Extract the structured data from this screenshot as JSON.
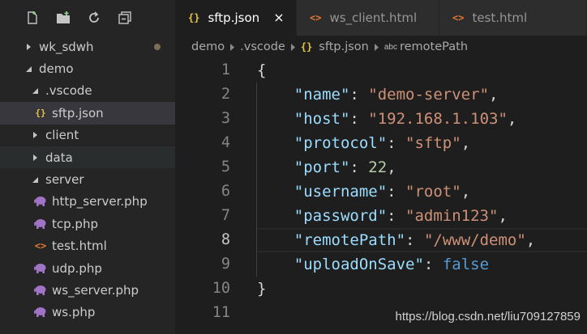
{
  "sidebar": {
    "toolbar": [
      {
        "name": "new-file-icon"
      },
      {
        "name": "new-folder-icon"
      },
      {
        "name": "refresh-icon"
      },
      {
        "name": "collapse-all-icon"
      }
    ],
    "tree": [
      {
        "label": "wk_sdwh",
        "indent": 0,
        "chevron": "right",
        "icon": null,
        "dot": true
      },
      {
        "label": "demo",
        "indent": 0,
        "chevron": "down",
        "icon": null
      },
      {
        "label": ".vscode",
        "indent": 1,
        "chevron": "down",
        "icon": null
      },
      {
        "label": "sftp.json",
        "indent": 2,
        "chevron": null,
        "icon": "json",
        "selected": true
      },
      {
        "label": "client",
        "indent": 1,
        "chevron": "right",
        "icon": null
      },
      {
        "label": "data",
        "indent": 1,
        "chevron": "right",
        "icon": null,
        "dim": true
      },
      {
        "label": "server",
        "indent": 1,
        "chevron": "down",
        "icon": null
      },
      {
        "label": "http_server.php",
        "indent": 2,
        "chevron": null,
        "icon": "php"
      },
      {
        "label": "tcp.php",
        "indent": 2,
        "chevron": null,
        "icon": "php"
      },
      {
        "label": "test.html",
        "indent": 2,
        "chevron": null,
        "icon": "html"
      },
      {
        "label": "udp.php",
        "indent": 2,
        "chevron": null,
        "icon": "php"
      },
      {
        "label": "ws_server.php",
        "indent": 2,
        "chevron": null,
        "icon": "php"
      },
      {
        "label": "ws.php",
        "indent": 2,
        "chevron": null,
        "icon": "php"
      }
    ]
  },
  "tabs": [
    {
      "label": "sftp.json",
      "icon": "json",
      "active": true,
      "close": "×"
    },
    {
      "label": "ws_client.html",
      "icon": "html",
      "active": false
    },
    {
      "label": "test.html",
      "icon": "html",
      "active": false
    }
  ],
  "icons": {
    "json": "{}",
    "html": "<>",
    "abc": "abc"
  },
  "breadcrumb": [
    "demo",
    ".vscode",
    "sftp.json",
    "remotePath"
  ],
  "editor": {
    "line_numbers": [
      "1",
      "2",
      "3",
      "4",
      "5",
      "6",
      "7",
      "8",
      "9",
      "10",
      "11"
    ],
    "current_line": 8,
    "lines": [
      [
        {
          "t": "p",
          "v": "{"
        }
      ],
      [
        {
          "t": "p",
          "v": "    "
        },
        {
          "t": "k",
          "v": "\"name\""
        },
        {
          "t": "p",
          "v": ": "
        },
        {
          "t": "s",
          "v": "\"demo-server\""
        },
        {
          "t": "p",
          "v": ","
        }
      ],
      [
        {
          "t": "p",
          "v": "    "
        },
        {
          "t": "k",
          "v": "\"host\""
        },
        {
          "t": "p",
          "v": ": "
        },
        {
          "t": "s",
          "v": "\"192.168.1.103\""
        },
        {
          "t": "p",
          "v": ","
        }
      ],
      [
        {
          "t": "p",
          "v": "    "
        },
        {
          "t": "k",
          "v": "\"protocol\""
        },
        {
          "t": "p",
          "v": ": "
        },
        {
          "t": "s",
          "v": "\"sftp\""
        },
        {
          "t": "p",
          "v": ","
        }
      ],
      [
        {
          "t": "p",
          "v": "    "
        },
        {
          "t": "k",
          "v": "\"port\""
        },
        {
          "t": "p",
          "v": ": "
        },
        {
          "t": "n",
          "v": "22"
        },
        {
          "t": "p",
          "v": ","
        }
      ],
      [
        {
          "t": "p",
          "v": "    "
        },
        {
          "t": "k",
          "v": "\"username\""
        },
        {
          "t": "p",
          "v": ": "
        },
        {
          "t": "s",
          "v": "\"root\""
        },
        {
          "t": "p",
          "v": ","
        }
      ],
      [
        {
          "t": "p",
          "v": "    "
        },
        {
          "t": "k",
          "v": "\"password\""
        },
        {
          "t": "p",
          "v": ": "
        },
        {
          "t": "s",
          "v": "\"admin123\""
        },
        {
          "t": "p",
          "v": ","
        }
      ],
      [
        {
          "t": "p",
          "v": "    "
        },
        {
          "t": "k",
          "v": "\"remotePath\""
        },
        {
          "t": "p",
          "v": ": "
        },
        {
          "t": "s",
          "v": "\"/www/demo\""
        },
        {
          "t": "p",
          "v": ","
        }
      ],
      [
        {
          "t": "p",
          "v": "    "
        },
        {
          "t": "k",
          "v": "\"uploadOnSave\""
        },
        {
          "t": "p",
          "v": ": "
        },
        {
          "t": "b",
          "v": "false"
        }
      ],
      [
        {
          "t": "p",
          "v": "}"
        }
      ],
      []
    ]
  },
  "watermark": "https://blog.csdn.net/liu709127859",
  "colors": {
    "editor_bg": "#1e1e1e",
    "sidebar_bg": "#252526",
    "json_key": "#9cdcfe",
    "json_string": "#ce9178",
    "json_number": "#b5cea8",
    "json_bool": "#569cd6",
    "php_icon": "#a074c4",
    "html_icon": "#e37933",
    "json_icon": "#e7c547"
  }
}
